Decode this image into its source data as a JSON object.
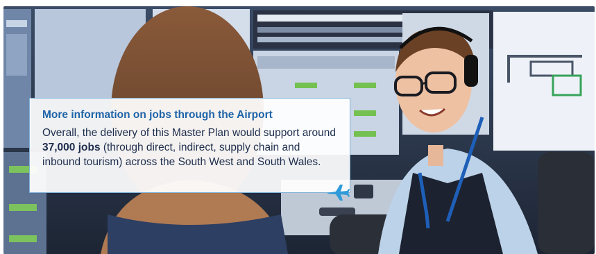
{
  "info_box": {
    "title": "More information on jobs through the Airport",
    "body_before": "Overall, the delivery of this Master Plan would support around ",
    "body_highlight": "37,000 jobs",
    "body_after": " (through direct, indirect, supply chain and inbound tourism) across the South West and South Wales."
  },
  "icons": {
    "plane": "airplane-icon"
  },
  "colors": {
    "title": "#1f64a8",
    "body": "#1e2e4d",
    "border": "#7fb2d8",
    "plane": "#2e9bd8"
  }
}
